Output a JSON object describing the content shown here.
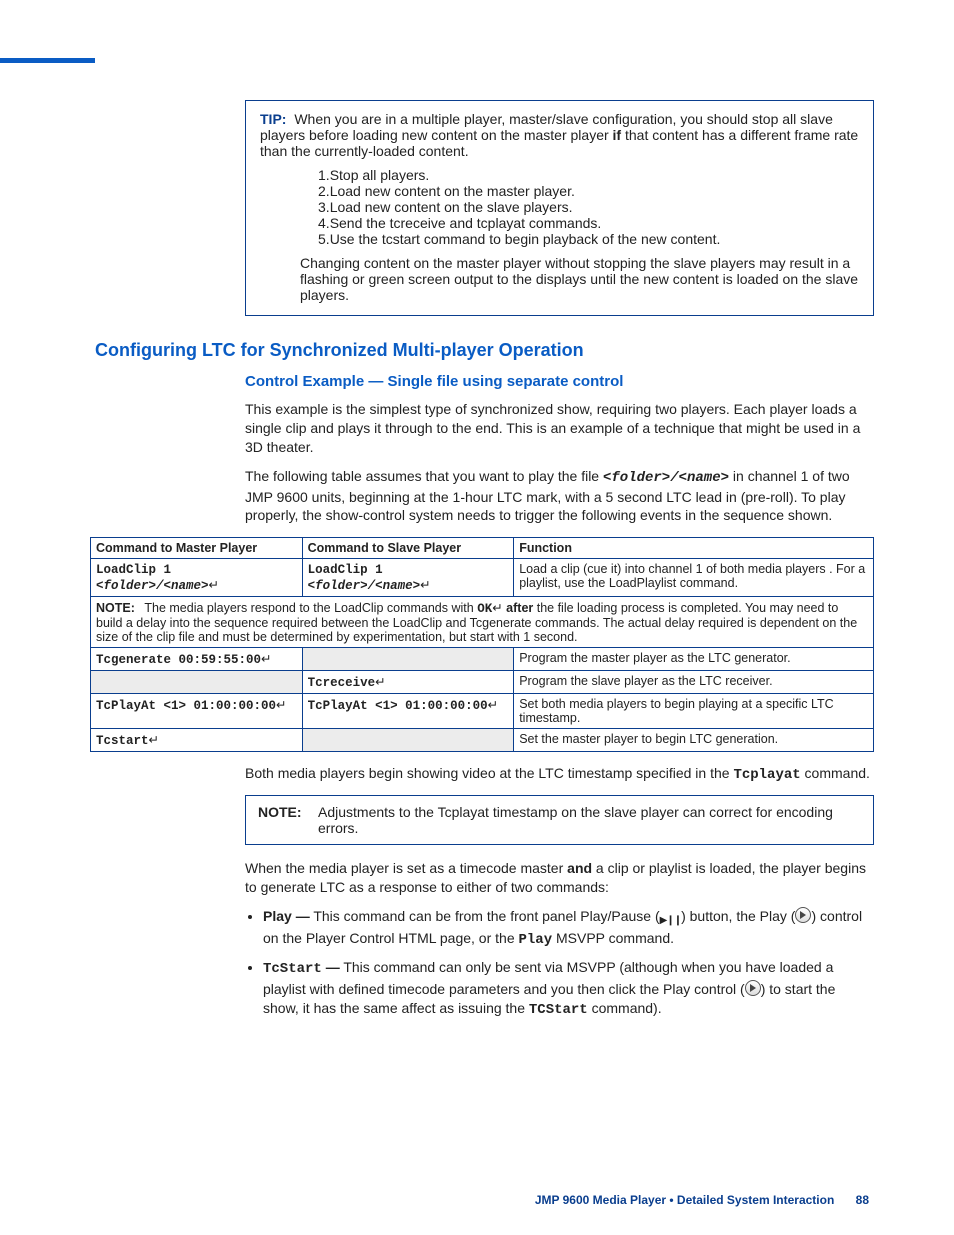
{
  "tip": {
    "label": "TIP:",
    "intro_a": "When you are in a multiple player, master/slave configuration, you should stop all slave players before loading new content on the master player ",
    "intro_bold": "if",
    "intro_b": " that content has a different frame rate than the currently-loaded content.",
    "steps": [
      "Stop all players.",
      "Load new content on the master player.",
      "Load new content on the slave players.",
      "Send the tcreceive and tcplayat commands.",
      "Use the tcstart command to begin playback of the new content."
    ],
    "outro": "Changing content on the master player without stopping the slave players may result in a flashing or green screen output to the displays until the new content is loaded on the slave players."
  },
  "h2": "Configuring LTC for Synchronized Multi-player Operation",
  "h3": "Control Example — Single file using separate control",
  "para1": "This example is the simplest type of synchronized show, requiring two players. Each player loads a single clip and plays it through to the end. This is an example of a technique that might be used in a 3D theater.",
  "para2_a": "The following table assumes that you want to play the file ",
  "para2_code": "<folder>/<name>",
  "para2_b": " in channel 1 of two JMP 9600 units, beginning at the 1-hour LTC mark, with a 5 second LTC lead in (pre-roll). To play properly, the show-control system needs to trigger the following events in the sequence shown.",
  "table": {
    "headers": [
      "Command to Master Player",
      "Command to Slave Player",
      "Function"
    ],
    "row1": {
      "master_prefix": "LoadClip 1 ",
      "master_arg": "<folder>/<name>",
      "slave_prefix": "LoadClip 1 ",
      "slave_arg": "<folder>/<name>",
      "func": "Load a clip (cue it) into channel 1 of both media players . For a playlist, use the LoadPlaylist command."
    },
    "note": {
      "label": "NOTE:",
      "text_a": "The media players respond to the LoadClip commands with ",
      "ok": "OK",
      "text_b": " after",
      "text_c": " the file loading process is completed. You may need to build a delay into the sequence required between the LoadClip and Tcgenerate commands. The actual delay required is dependent on the size of the clip file and must be determined by experimentation, but start with 1 second."
    },
    "row2": {
      "master": "Tcgenerate 00:59:55:00",
      "func": "Program the master player as the LTC generator."
    },
    "row3": {
      "slave": "Tcreceive",
      "func": "Program the slave player as the LTC receiver."
    },
    "row4": {
      "master": "TcPlayAt <1> 01:00:00:00",
      "slave": "TcPlayAt <1> 01:00:00:00",
      "func": "Set both media players to begin playing at a specific LTC timestamp."
    },
    "row5": {
      "master": "Tcstart",
      "func": "Set the master player to begin LTC generation."
    }
  },
  "para3_a": "Both media players begin showing video at the LTC timestamp specified in the ",
  "para3_code": "Tcplayat",
  "para3_b": " command.",
  "note2": {
    "label": "NOTE:",
    "text": "Adjustments to the Tcplayat timestamp on the slave player can correct for encoding errors."
  },
  "para4_a": "When the media player is set as a timecode master ",
  "para4_bold": "and",
  "para4_b": " a clip or playlist is loaded, the player begins to generate LTC as a response to either of two commands:",
  "bullets": {
    "play_label": "Play —",
    "play_a": " This command can be from the front panel Play/Pause (",
    "play_b": ") button, the Play (",
    "play_c": ") control on the Player Control HTML page, or the ",
    "play_code": "Play",
    "play_d": " MSVPP command.",
    "tcstart_label": "TcStart",
    "tcstart_dash": " —",
    "tcstart_a": " This command can only be sent via MSVPP (although when you have loaded a playlist with defined timecode parameters and you then click the Play control (",
    "tcstart_b": ") to start the show, it has the same affect as issuing the ",
    "tcstart_code": "TCStart",
    "tcstart_c": " command)."
  },
  "footer": {
    "text": "JMP 9600 Media Player • Detailed System Interaction",
    "page": "88"
  }
}
